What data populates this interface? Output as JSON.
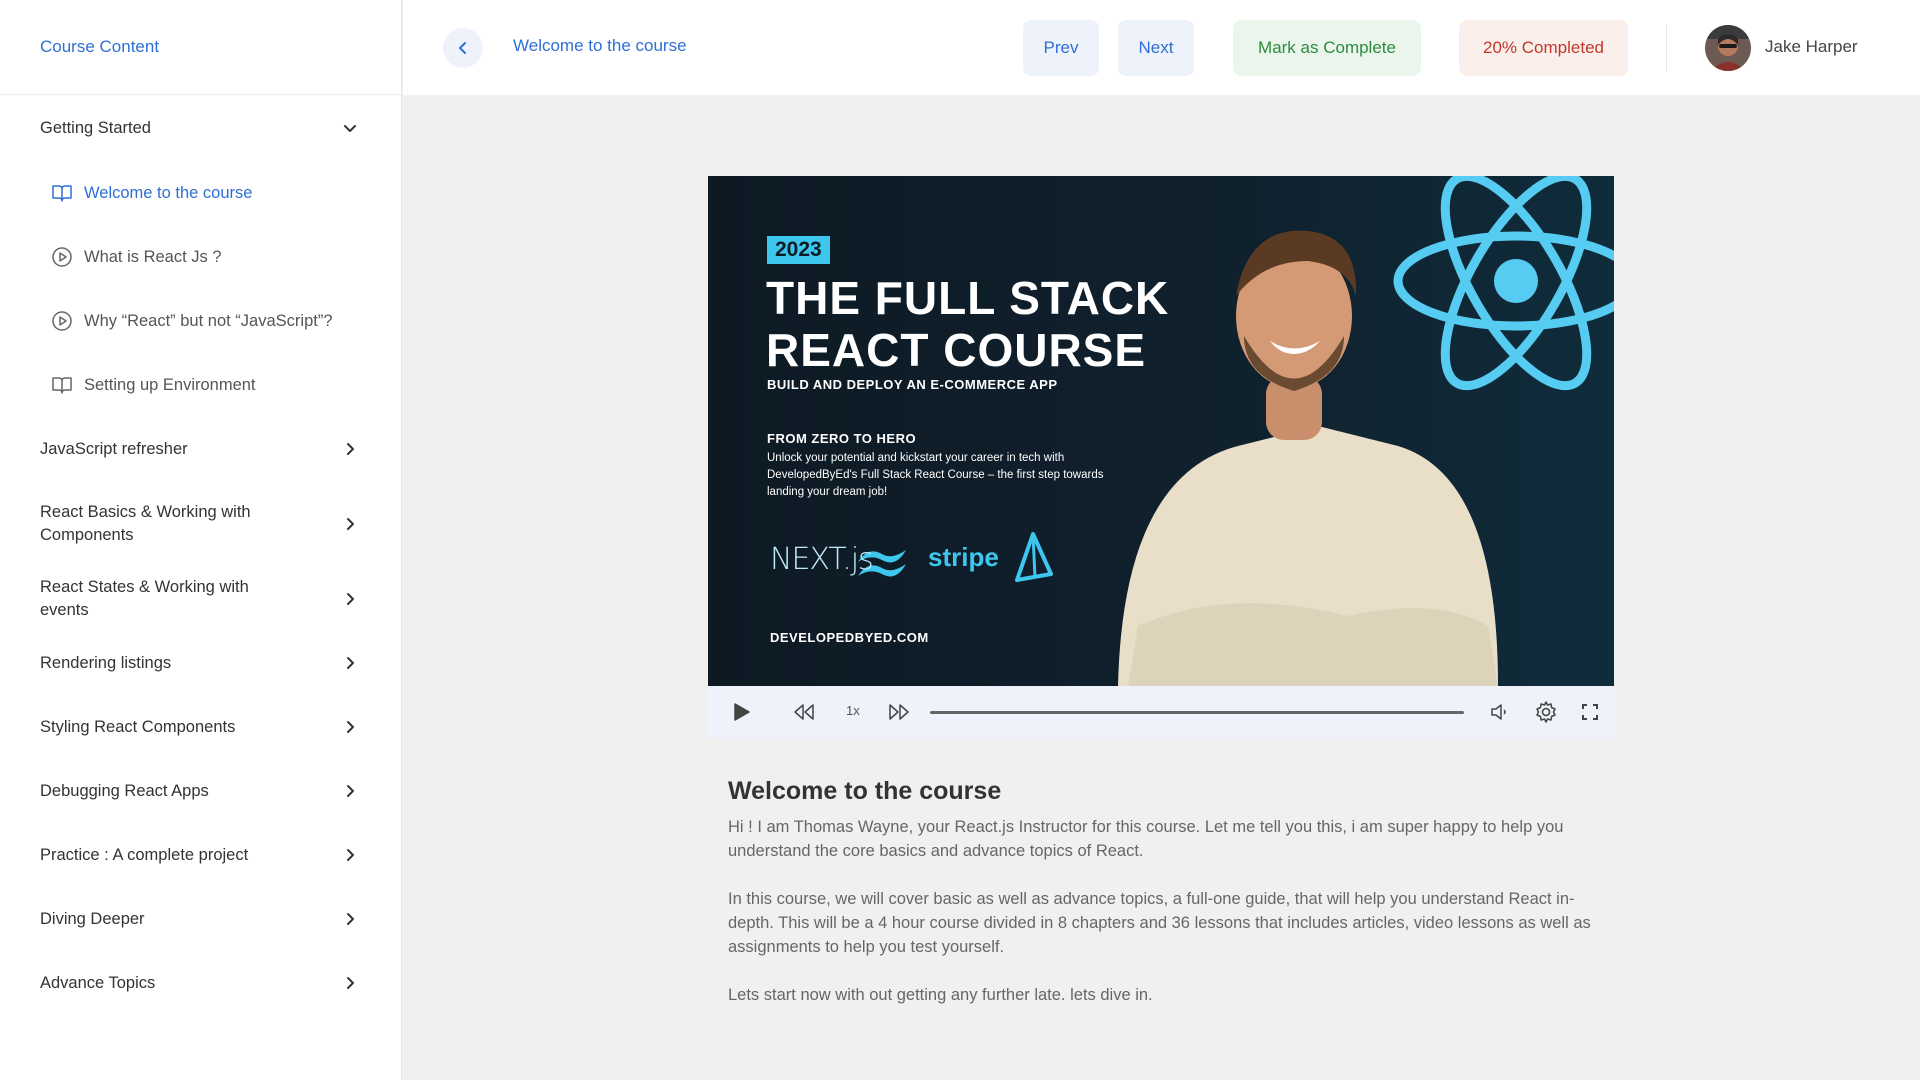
{
  "sidebar": {
    "title": "Course Content",
    "sections": [
      {
        "label": "Getting Started",
        "expanded": true,
        "lessons": [
          {
            "label": "Welcome to the course",
            "icon": "book-icon",
            "active": true
          },
          {
            "label": "What is React Js ?",
            "icon": "play-circle-icon",
            "active": false
          },
          {
            "label": "Why “React” but not “JavaScript”?",
            "icon": "play-circle-icon",
            "active": false
          },
          {
            "label": "Setting up Environment",
            "icon": "book-icon",
            "active": false
          }
        ]
      },
      {
        "label": "JavaScript refresher"
      },
      {
        "label": "React Basics & Working with Components"
      },
      {
        "label": "React States & Working with events"
      },
      {
        "label": "Rendering listings"
      },
      {
        "label": "Styling React Components"
      },
      {
        "label": "Debugging React Apps"
      },
      {
        "label": "Practice : A complete project"
      },
      {
        "label": "Diving Deeper"
      },
      {
        "label": "Advance Topics"
      }
    ]
  },
  "topbar": {
    "breadcrumb": "Welcome to the course",
    "prev_label": "Prev",
    "next_label": "Next",
    "complete_label": "Mark as Complete",
    "progress_label": "20% Completed",
    "user_name": "Jake Harper"
  },
  "video": {
    "badge": "2023",
    "title_line1": "THE FULL STACK",
    "title_line2": "REACT COURSE",
    "subtitle": "BUILD AND DEPLOY AN E-COMMERCE APP",
    "hero": "FROM ZERO TO HERO",
    "description": "Unlock your potential and kickstart your career in tech with DevelopedByEd's Full Stack React Course – the first step towards landing your dream job!",
    "logo_next": "NEXT.js",
    "logo_stripe": "stripe",
    "site": "DEVELOPEDBYED.COM",
    "speed": "1x",
    "progress": 0
  },
  "content": {
    "title": "Welcome to the course",
    "paragraphs": [
      "Hi ! I am Thomas Wayne, your React.js Instructor for this course. Let me tell  you this, i am super happy to help you understand the core basics and advance topics of React.",
      "In this course, we will cover basic as well as advance topics, a full-one guide, that will help you understand React  in-depth. This will be a 4 hour course divided in 8 chapters and 36 lessons that includes articles, video lessons as well as assignments to help you test yourself.",
      "Lets start now with out getting any further late. lets dive in."
    ]
  },
  "colors": {
    "accent": "#2f6fd6",
    "success": "#2f8a3f",
    "danger": "#c0392b",
    "react_blue": "#3ec7ee"
  }
}
